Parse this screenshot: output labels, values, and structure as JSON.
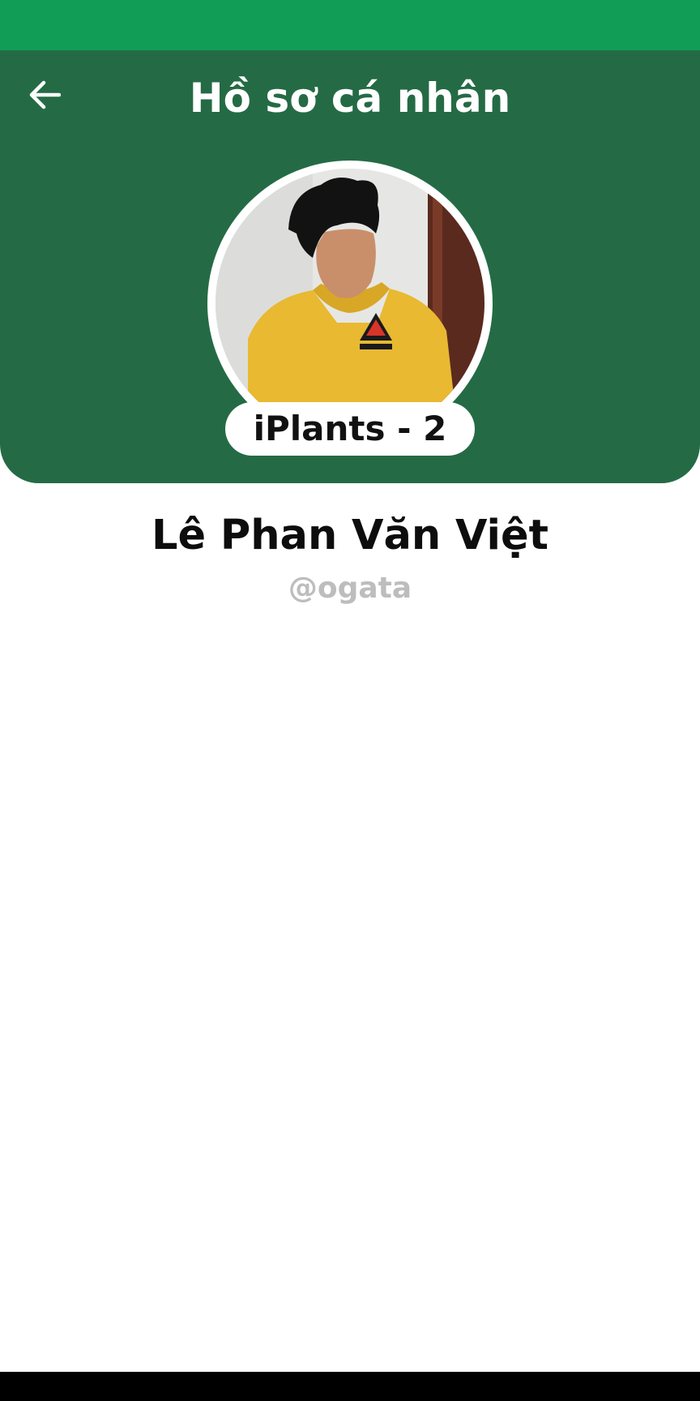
{
  "header": {
    "title": "Hồ sơ cá nhân",
    "back_icon": "arrow-left-icon",
    "color": "#246B45"
  },
  "status_bar": {
    "color": "#129D57"
  },
  "profile": {
    "badge": "iPlants - 2",
    "full_name": "Lê Phan Văn Việt",
    "username": "@ogata",
    "avatar": "profile-photo"
  }
}
